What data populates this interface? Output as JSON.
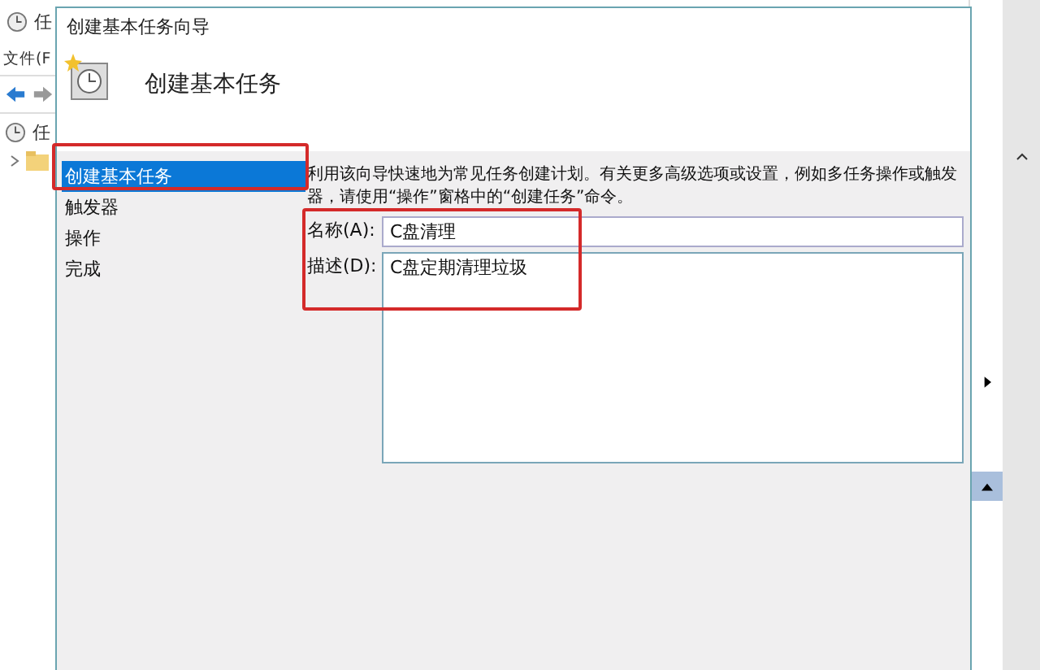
{
  "background_window": {
    "title": "任",
    "menu": "文件(F",
    "tree_item": "任"
  },
  "dialog": {
    "title": "创建基本任务向导",
    "header": "创建基本任务",
    "steps": [
      {
        "label": "创建基本任务",
        "selected": true
      },
      {
        "label": "触发器",
        "selected": false
      },
      {
        "label": "操作",
        "selected": false
      },
      {
        "label": "完成",
        "selected": false
      }
    ],
    "intro": "利用该向导快速地为常见任务创建计划。有关更多高级选项或设置，例如多任务操作或触发器，请使用“操作”窗格中的“创建任务”命令。",
    "name_label": "名称(A):",
    "name_value": "C盘清理",
    "description_label": "描述(D):",
    "description_value": "C盘定期清理垃圾"
  }
}
